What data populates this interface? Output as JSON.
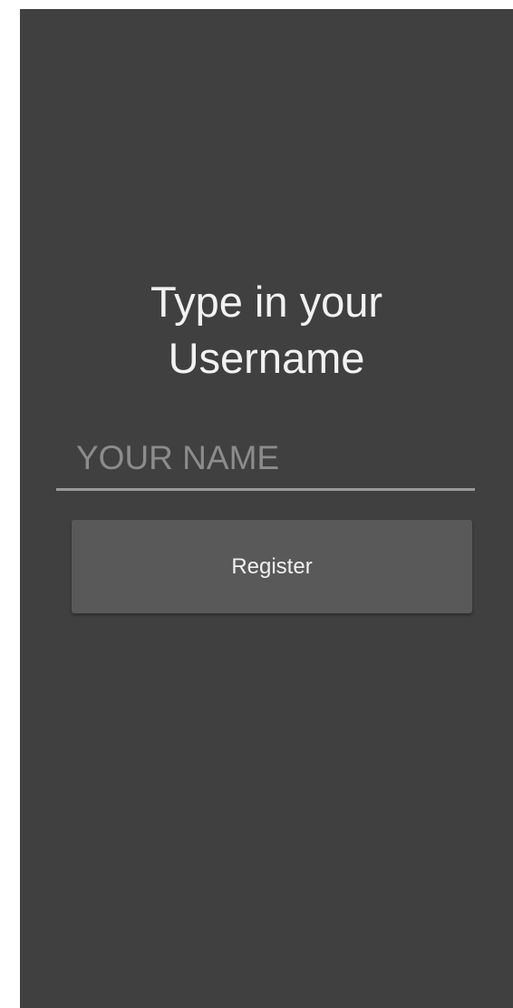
{
  "screen": {
    "title": "Type in your\nUsername",
    "name_field": {
      "value": "",
      "placeholder": "YOUR NAME"
    },
    "register_label": "Register"
  },
  "colors": {
    "background": "#404040",
    "button": "#595959",
    "underline": "#9a9a9a",
    "text": "#f2f2f2",
    "placeholder": "#8c8c8c"
  }
}
